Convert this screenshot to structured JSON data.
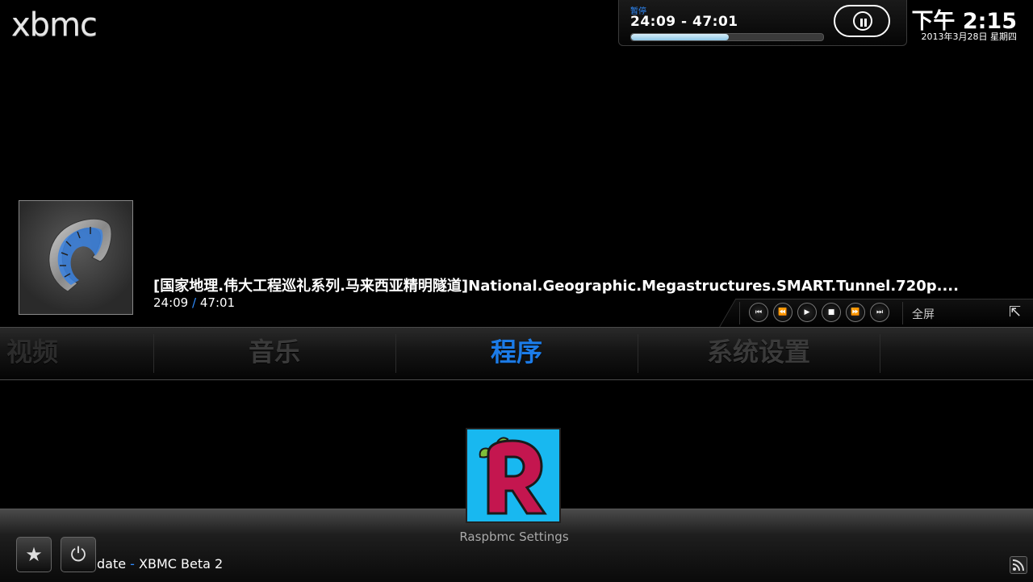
{
  "app": {
    "logo_text": "xbmc"
  },
  "now_playing": {
    "state": "暂停",
    "time": "24:09 - 47:01",
    "progress": 0.51
  },
  "clock": {
    "time": "下午 2:15",
    "date": "2013年3月28日 星期四"
  },
  "media": {
    "title": "[国家地理.伟大工程巡礼系列.马来西亚精明隧道]National.Geographic.Megastructures.SMART.Tunnel.720p....",
    "elapsed": "24:09",
    "separator": "/",
    "total": "47:01"
  },
  "transport": {
    "buttons": [
      {
        "name": "skip-back",
        "glyph": "⏮"
      },
      {
        "name": "rewind",
        "glyph": "⏪"
      },
      {
        "name": "play",
        "glyph": "▶"
      },
      {
        "name": "stop",
        "glyph": "■"
      },
      {
        "name": "fast-forward",
        "glyph": "⏩"
      },
      {
        "name": "skip-forward",
        "glyph": "⏭"
      }
    ],
    "fullscreen_label": "全屏",
    "fullscreen_icon": "⇱"
  },
  "menu": {
    "items": [
      "视频",
      "音乐",
      "程序",
      "系统设置"
    ],
    "active": "程序"
  },
  "submenu": {
    "tile_label": "Raspbmc Settings"
  },
  "bottom": {
    "ticker_text": "date",
    "ticker_sep": "-",
    "ticker_text2": "XBMC Beta 2",
    "favourites_icon": "★",
    "power_icon": "⏻"
  },
  "colors": {
    "accent": "#1c7ce8",
    "tile_bg": "#18b8f0",
    "logo_pink": "#c4164f"
  }
}
